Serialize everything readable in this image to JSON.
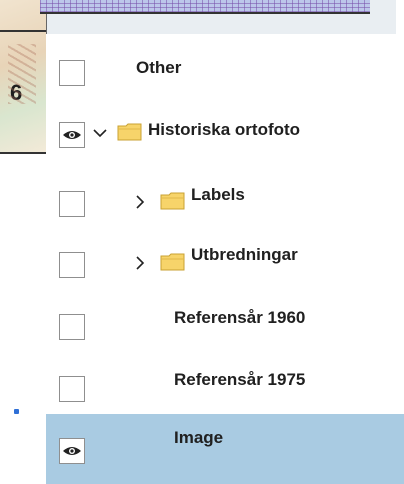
{
  "map": {
    "number_fragment": "6"
  },
  "layers": [
    {
      "label": "Other",
      "visible": false,
      "selected": false,
      "expander": "",
      "folder": false
    },
    {
      "label": "Historiska ortofoto",
      "visible": true,
      "selected": false,
      "expander": "expanded",
      "folder": true
    },
    {
      "label": "Labels",
      "visible": false,
      "selected": false,
      "expander": "collapsed",
      "folder": true
    },
    {
      "label": "Utbredningar",
      "visible": false,
      "selected": false,
      "expander": "collapsed",
      "folder": true
    },
    {
      "label": "Referensår 1960",
      "visible": false,
      "selected": false,
      "expander": "",
      "folder": false
    },
    {
      "label": "Referensår 1975",
      "visible": false,
      "selected": false,
      "expander": "",
      "folder": false
    },
    {
      "label": "Image",
      "visible": true,
      "selected": true,
      "expander": "",
      "folder": false
    }
  ],
  "icons": {
    "visibility": "eye-icon",
    "folder": "folder-icon",
    "expanded": "chevron-down-icon",
    "collapsed": "chevron-right-icon"
  },
  "colors": {
    "selected_row": "#a9cbe2",
    "folder_fill": "#f7d46a",
    "folder_stroke": "#c9a233"
  }
}
